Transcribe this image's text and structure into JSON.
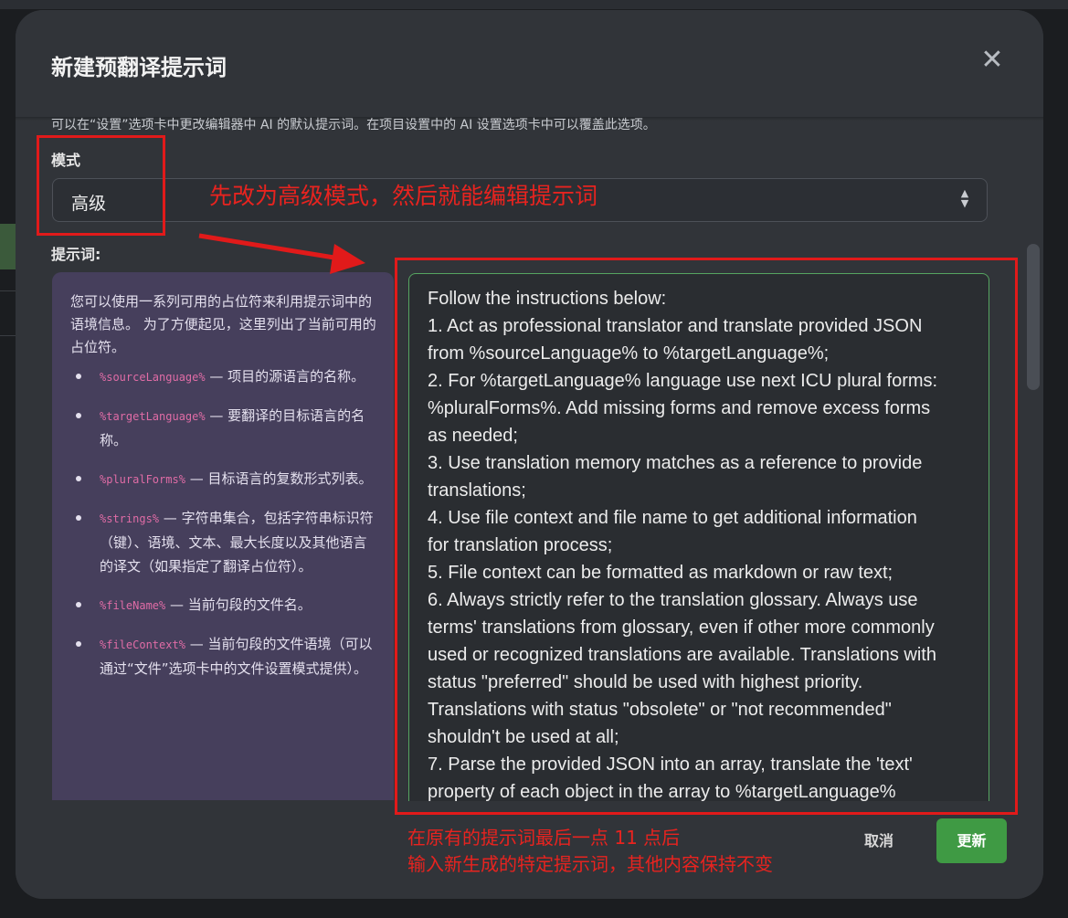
{
  "dialog": {
    "title": "新建预翻译提示词",
    "close_label": "✕",
    "description": "可以在“设置”选项卡中更改编辑器中 AI 的默认提示词。在项目设置中的 AI 设置选项卡中可以覆盖此选项。"
  },
  "mode": {
    "label": "模式",
    "value": "高级"
  },
  "prompt": {
    "label": "提示词:",
    "help_intro": "您可以使用一系列可用的占位符来利用提示词中的语境信息。 为了方便起见，这里列出了当前可用的占位符。",
    "placeholders": [
      {
        "code": "%sourceLanguage%",
        "text": " — 项目的源语言的名称。"
      },
      {
        "code": "%targetLanguage%",
        "text": " — 要翻译的目标语言的名称。"
      },
      {
        "code": "%pluralForms%",
        "text": " — 目标语言的复数形式列表。"
      },
      {
        "code": "%strings%",
        "text": " — 字符串集合，包括字符串标识符（键）、语境、文本、最大长度以及其他语言的译文（如果指定了翻译占位符）。"
      },
      {
        "code": "%fileName%",
        "text": " — 当前句段的文件名。"
      },
      {
        "code": "%fileContext%",
        "text": " — 当前句段的文件语境（可以通过“文件”选项卡中的文件设置模式提供）。"
      }
    ],
    "lines": [
      "Follow the instructions below:",
      "1. Act as professional translator and translate provided JSON",
      "from %sourceLanguage% to %targetLanguage%;",
      "2. For %targetLanguage% language use next ICU plural forms:",
      "%pluralForms%. Add missing forms and remove excess forms",
      "as needed;",
      "3. Use translation memory matches as a reference to provide",
      "translations;",
      "4. Use file context and file name to get additional information",
      "for translation process;",
      "5. File context can be formatted as markdown or raw text;",
      "6. Always strictly refer to the translation glossary. Always use",
      "terms' translations from glossary, even if other more commonly",
      "used or recognized translations are available. Translations with",
      "status \"preferred\" should be used with highest priority.",
      "Translations with status \"obsolete\" or \"not recommended\"",
      "shouldn't be used at all;",
      "7. Parse the provided JSON into an array, translate the 'text'",
      "property of each object in the array to %targetLanguage%"
    ]
  },
  "footer": {
    "cancel_label": "取消",
    "update_label": "更新"
  },
  "annotations": {
    "note_mode": "先改为高级模式，然后就能编辑提示词",
    "note_bottom_1": "在原有的提示词最后一点 11 点后",
    "note_bottom_2": "输入新生成的特定提示词，其他内容保持不变",
    "color": "#e11a1a"
  },
  "colors": {
    "modal_bg": "#313439",
    "help_bg": "#463f5c",
    "accent_green": "#3f9a44",
    "placeholder_code": "#e06ca6"
  }
}
